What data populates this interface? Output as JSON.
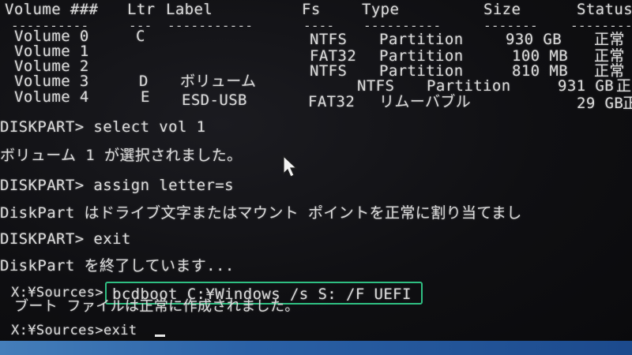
{
  "table": {
    "headers": {
      "volume": "Volume ###",
      "ltr": "Ltr",
      "label": "Label",
      "fs": "Fs",
      "type": "Type",
      "size": "Size",
      "status": "Status"
    },
    "separators": {
      "volume": "----------",
      "ltr": "---",
      "label": "-----------",
      "fs": "----",
      "type": "----------",
      "size": "-------",
      "status": "---------"
    },
    "rows": [
      {
        "volume": "Volume 0",
        "ltr": "C",
        "label": "",
        "fs": "NTFS",
        "type": "Partition",
        "size": "930 GB",
        "status": "正常"
      },
      {
        "volume": "Volume 1",
        "ltr": "",
        "label": "",
        "fs": "FAT32",
        "type": "Partition",
        "size": "100 MB",
        "status": "正常"
      },
      {
        "volume": "Volume 2",
        "ltr": "",
        "label": "",
        "fs": "NTFS",
        "type": "Partition",
        "size": "810 MB",
        "status": "正常"
      },
      {
        "volume": "Volume 3",
        "ltr": "D",
        "label": "ボリューム",
        "fs": "NTFS",
        "type": "Partition",
        "size": "931 GB",
        "status": "正"
      },
      {
        "volume": "Volume 4",
        "ltr": "E",
        "label": "ESD-USB",
        "fs": "FAT32",
        "type": "リムーバブル",
        "size": "29 GB",
        "status": "正"
      }
    ]
  },
  "console": {
    "lines": [
      "DISKPART> select vol 1",
      "ボリューム 1 が選択されました。",
      "DISKPART> assign letter=s",
      "DiskPart はドライブ文字またはマウント ポイントを正常に割り当てまし",
      "DISKPART> exit",
      "DiskPart を終了しています...",
      "X:¥Sources>",
      "bcdboot C:¥Windows /s S: /F UEFI",
      "ブート ファイルは正常に作成されました。",
      "X:¥Sources>exit"
    ]
  },
  "colors": {
    "highlight": "#2fbf82",
    "text": "#dadada",
    "background": "#101013"
  },
  "icons": {
    "pointer": "mouse-pointer-icon",
    "cursor": "text-cursor"
  }
}
